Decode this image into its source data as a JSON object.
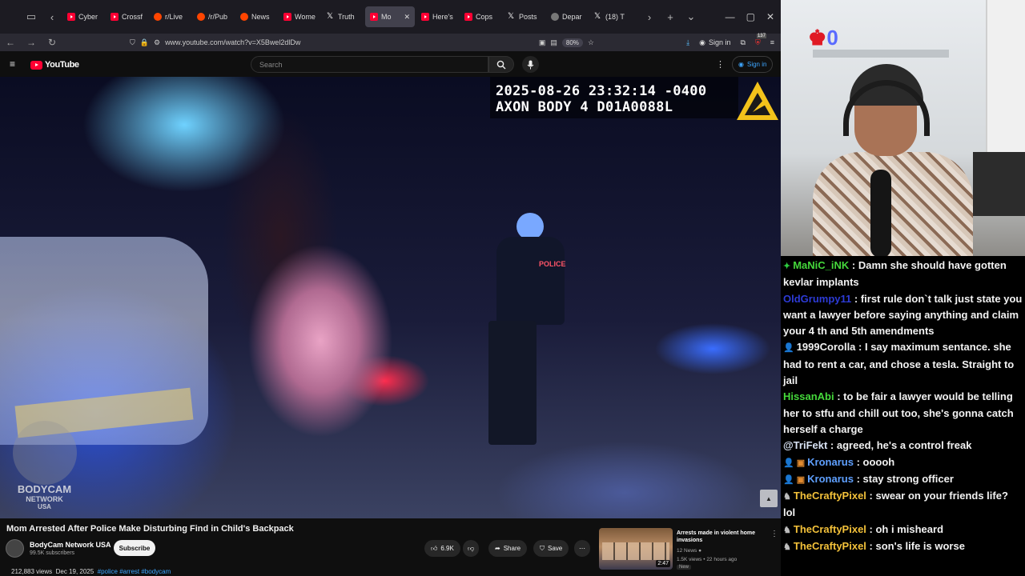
{
  "browser": {
    "tabs": [
      {
        "label": "Cyber",
        "icon": "youtube-icon",
        "active": false
      },
      {
        "label": "Crossf",
        "icon": "youtube-icon",
        "active": false
      },
      {
        "label": "r/Live",
        "icon": "reddit-icon",
        "active": false
      },
      {
        "label": "/r/Pub",
        "icon": "reddit-icon",
        "active": false
      },
      {
        "label": "News",
        "icon": "reddit-icon",
        "active": false
      },
      {
        "label": "Wome",
        "icon": "youtube-icon",
        "active": false
      },
      {
        "label": "Truth",
        "icon": "x-icon",
        "active": false
      },
      {
        "label": "Mo",
        "icon": "youtube-icon",
        "active": true
      },
      {
        "label": "Here's",
        "icon": "youtube-icon",
        "active": false
      },
      {
        "label": "Cops",
        "icon": "youtube-icon",
        "active": false
      },
      {
        "label": "Posts",
        "icon": "x-icon",
        "active": false
      },
      {
        "label": "Depar",
        "icon": "github-icon",
        "active": false
      },
      {
        "label": "(18) T",
        "icon": "x-icon",
        "active": false
      }
    ],
    "url": "www.youtube.com/watch?v=X5Bwel2dlDw",
    "zoom": "80%",
    "sign_in": "Sign in",
    "ext_badge": "137"
  },
  "youtube": {
    "logo_text": "YouTube",
    "search_placeholder": "Search",
    "sign_in": "Sign in"
  },
  "video": {
    "timestamp_line1": "2025-08-26 23:32:14 -0400",
    "timestamp_line2": "AXON BODY 4 D01A0088L",
    "watermark_top": "BODYCAM",
    "watermark_mid": "NETWORK",
    "watermark_bot": "USA",
    "officer_label": "POLICE",
    "title": "Mom Arrested After Police Make Disturbing Find in Child's Backpack",
    "channel": "BodyCam Network USA",
    "subscribers": "99.5K subscribers",
    "subscribe_label": "Subscribe",
    "likes": "6.9K",
    "share_label": "Share",
    "save_label": "Save",
    "views": "212,883 views",
    "date": "Dec 19, 2025",
    "tags": "#police #arrest #bodycam"
  },
  "recommendation": {
    "title": "Arrests made in violent home invasions",
    "channel": "12 News",
    "meta": "1.5K views • 22 hours ago",
    "badge": "New",
    "duration": "2:47"
  },
  "stream": {
    "logo_text": "0"
  },
  "chat": [
    {
      "badge": "✦",
      "badge_color": "#2ecc40",
      "user": "MaNiC_iNK",
      "color": "#45d83b",
      "text": "Damn she should have gotten kevlar implants"
    },
    {
      "badge": "",
      "badge_color": "",
      "user": "OldGrumpy11",
      "color": "#2d3bd6",
      "text": "first rule don`t talk just state you want a lawyer before saying anything and claim your 4 th and 5th amendments"
    },
    {
      "badge": "👤",
      "badge_color": "#3a7bd5",
      "user": "1999Corolla",
      "color": "#f2f2f2",
      "text": "I say maximum sentance. she had to rent a car, and chose a tesla. Straight to jail"
    },
    {
      "badge": "",
      "badge_color": "",
      "user": "HissanAbi",
      "color": "#45d83b",
      "text": "to be fair a lawyer would be telling her to stfu and chill out too, she's gonna catch herself a charge"
    },
    {
      "badge": "",
      "badge_color": "",
      "user": "@TriFekt",
      "color": "#d9e3f5",
      "text": "agreed, he's a control freak"
    },
    {
      "badge": "👤 ▣",
      "badge_color": "#e08a30",
      "user": "Kronarus",
      "color": "#5fa0ff",
      "text": "ooooh"
    },
    {
      "badge": "👤 ▣",
      "badge_color": "#e08a30",
      "user": "Kronarus",
      "color": "#5fa0ff",
      "text": "stay strong officer"
    },
    {
      "badge": "♞",
      "badge_color": "#bbbbbb",
      "user": "TheCraftyPixel",
      "color": "#f3c13a",
      "text": "swear on your friends life? lol"
    },
    {
      "badge": "♞",
      "badge_color": "#bbbbbb",
      "user": "TheCraftyPixel",
      "color": "#f3c13a",
      "text": "oh i misheard"
    },
    {
      "badge": "♞",
      "badge_color": "#bbbbbb",
      "user": "TheCraftyPixel",
      "color": "#f3c13a",
      "text": "son's life is worse"
    }
  ]
}
